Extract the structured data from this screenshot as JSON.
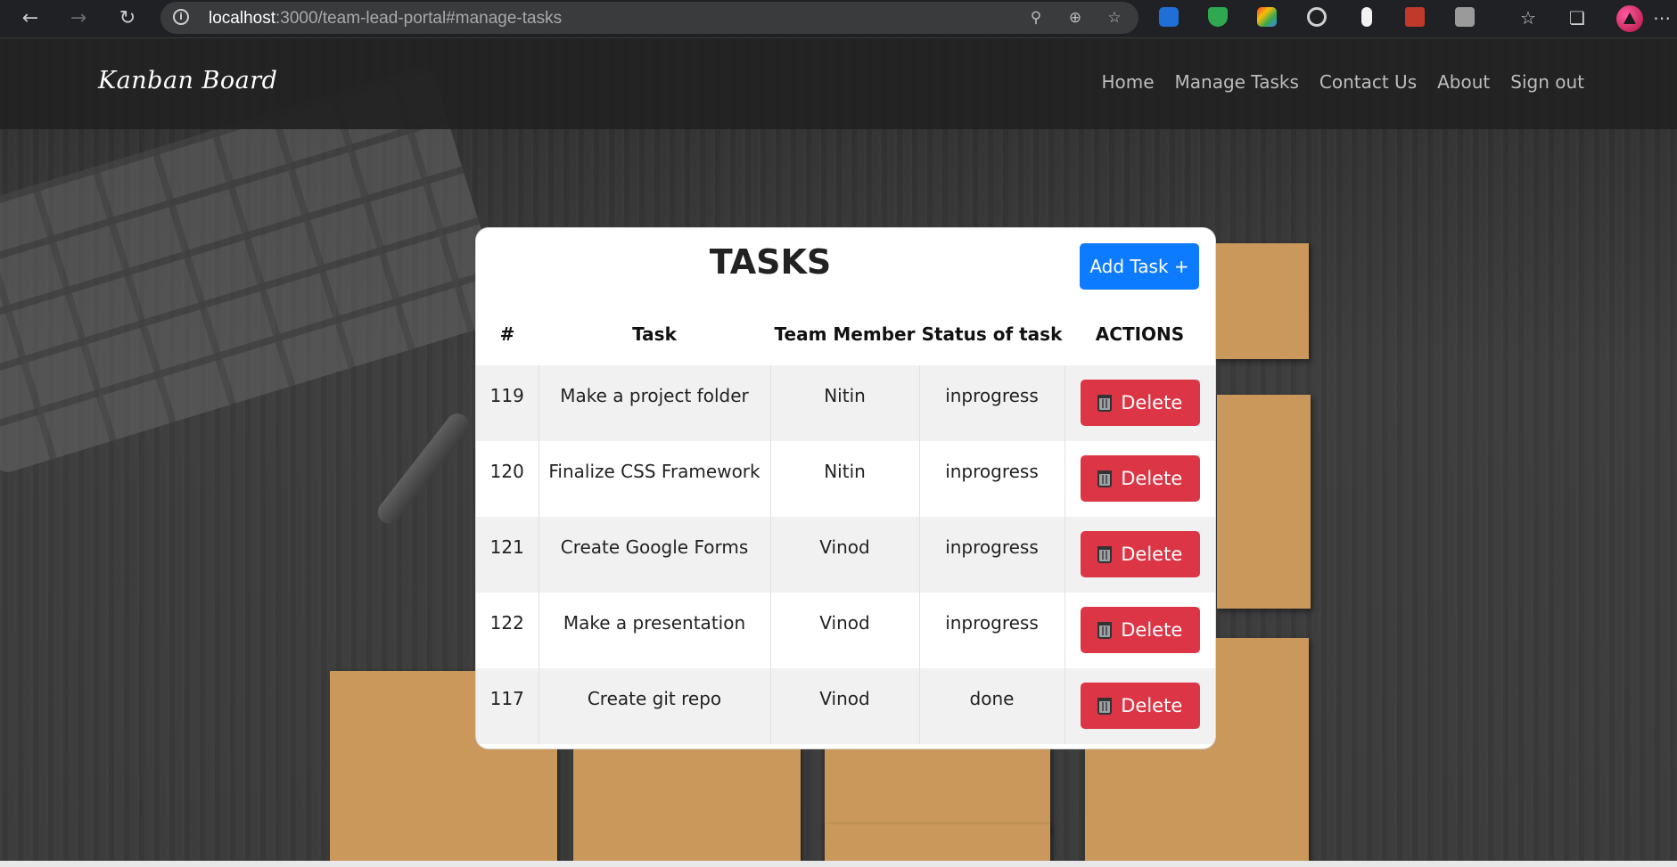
{
  "browser": {
    "url_host": "localhost",
    "url_path": ":3000/team-lead-portal#manage-tasks"
  },
  "navbar": {
    "brand": "Kanban Board",
    "links": [
      "Home",
      "Manage Tasks",
      "Contact Us",
      "About",
      "Sign out"
    ]
  },
  "tasks_card": {
    "title": "TASKS",
    "add_button": "Add Task +",
    "columns": [
      "#",
      "Task",
      "Team Member",
      "Status of task",
      "ACTIONS"
    ],
    "delete_label": "Delete",
    "rows": [
      {
        "id": "119",
        "task": "Make a project folder",
        "member": "Nitin",
        "status": "inprogress"
      },
      {
        "id": "120",
        "task": "Finalize CSS Framework",
        "member": "Nitin",
        "status": "inprogress"
      },
      {
        "id": "121",
        "task": "Create Google Forms",
        "member": "Vinod",
        "status": "inprogress"
      },
      {
        "id": "122",
        "task": "Make a presentation",
        "member": "Vinod",
        "status": "inprogress"
      },
      {
        "id": "117",
        "task": "Create git repo",
        "member": "Vinod",
        "status": "done"
      }
    ]
  },
  "colors": {
    "primary": "#0d7bff",
    "danger": "#dc3545",
    "navbar_bg": "#222222"
  }
}
